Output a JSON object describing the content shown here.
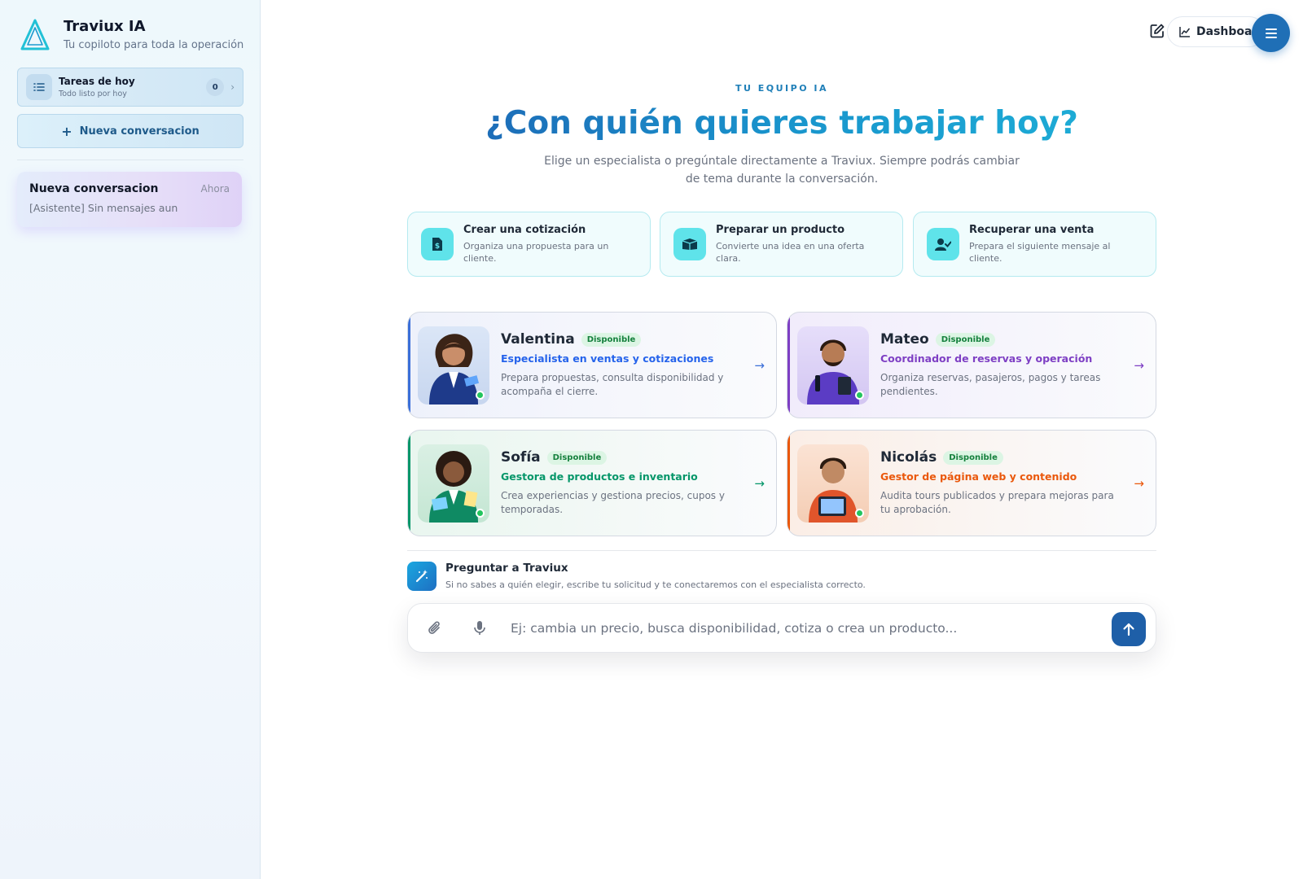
{
  "sidebar": {
    "brand_title": "Traviux IA",
    "brand_subtitle": "Tu copiloto para toda la operación",
    "tasks": {
      "title": "Tareas de hoy",
      "subtitle": "Todo listo por hoy",
      "count": "0"
    },
    "new_conversation_label": "Nueva conversacion",
    "conversations": [
      {
        "title": "Nueva conversacion",
        "time": "Ahora",
        "preview": "[Asistente] Sin mensajes aun"
      }
    ]
  },
  "header": {
    "dashboard_label": "Dashboa"
  },
  "main": {
    "eyebrow": "TU EQUIPO IA",
    "headline": "¿Con quién quieres trabajar hoy?",
    "subline": "Elige un especialista o pregúntale directamente a Traviux. Siempre podrás cambiar de tema durante la conversación.",
    "quick_actions": [
      {
        "title": "Crear una cotización",
        "desc": "Organiza una propuesta para un cliente.",
        "icon": "document-dollar-icon"
      },
      {
        "title": "Preparar un producto",
        "desc": "Convierte una idea en una oferta clara.",
        "icon": "box-icon"
      },
      {
        "title": "Recuperar una venta",
        "desc": "Prepara el siguiente mensaje al cliente.",
        "icon": "user-check-icon"
      }
    ],
    "agents": [
      {
        "name": "Valentina",
        "badge": "Disponible",
        "role": "Especialista en ventas y cotizaciones",
        "desc": "Prepara propuestas, consulta disponibilidad y acompaña el cierre.",
        "color": "#2563eb"
      },
      {
        "name": "Mateo",
        "badge": "Disponible",
        "role": "Coordinador de reservas y operación",
        "desc": "Organiza reservas, pasajeros, pagos y tareas pendientes.",
        "color": "#7e3fc4"
      },
      {
        "name": "Sofía",
        "badge": "Disponible",
        "role": "Gestora de productos e inventario",
        "desc": "Crea experiencias y gestiona precios, cupos y temporadas.",
        "color": "#059669"
      },
      {
        "name": "Nicolás",
        "badge": "Disponible",
        "role": "Gestor de página web y contenido",
        "desc": "Audita tours publicados y prepara mejoras para tu aprobación.",
        "color": "#ea580c"
      }
    ],
    "ask": {
      "title": "Preguntar a Traviux",
      "subtitle": "Si no sabes a quién elegir, escribe tu solicitud y te conectaremos con el especialista correcto."
    },
    "composer": {
      "placeholder": "Ej: cambia un precio, busca disponibilidad, cotiza o crea un producto...",
      "value": ""
    }
  },
  "colors": {
    "primary": "#1e5fa8",
    "accent": "#1994cc",
    "available": "#22c55e"
  }
}
